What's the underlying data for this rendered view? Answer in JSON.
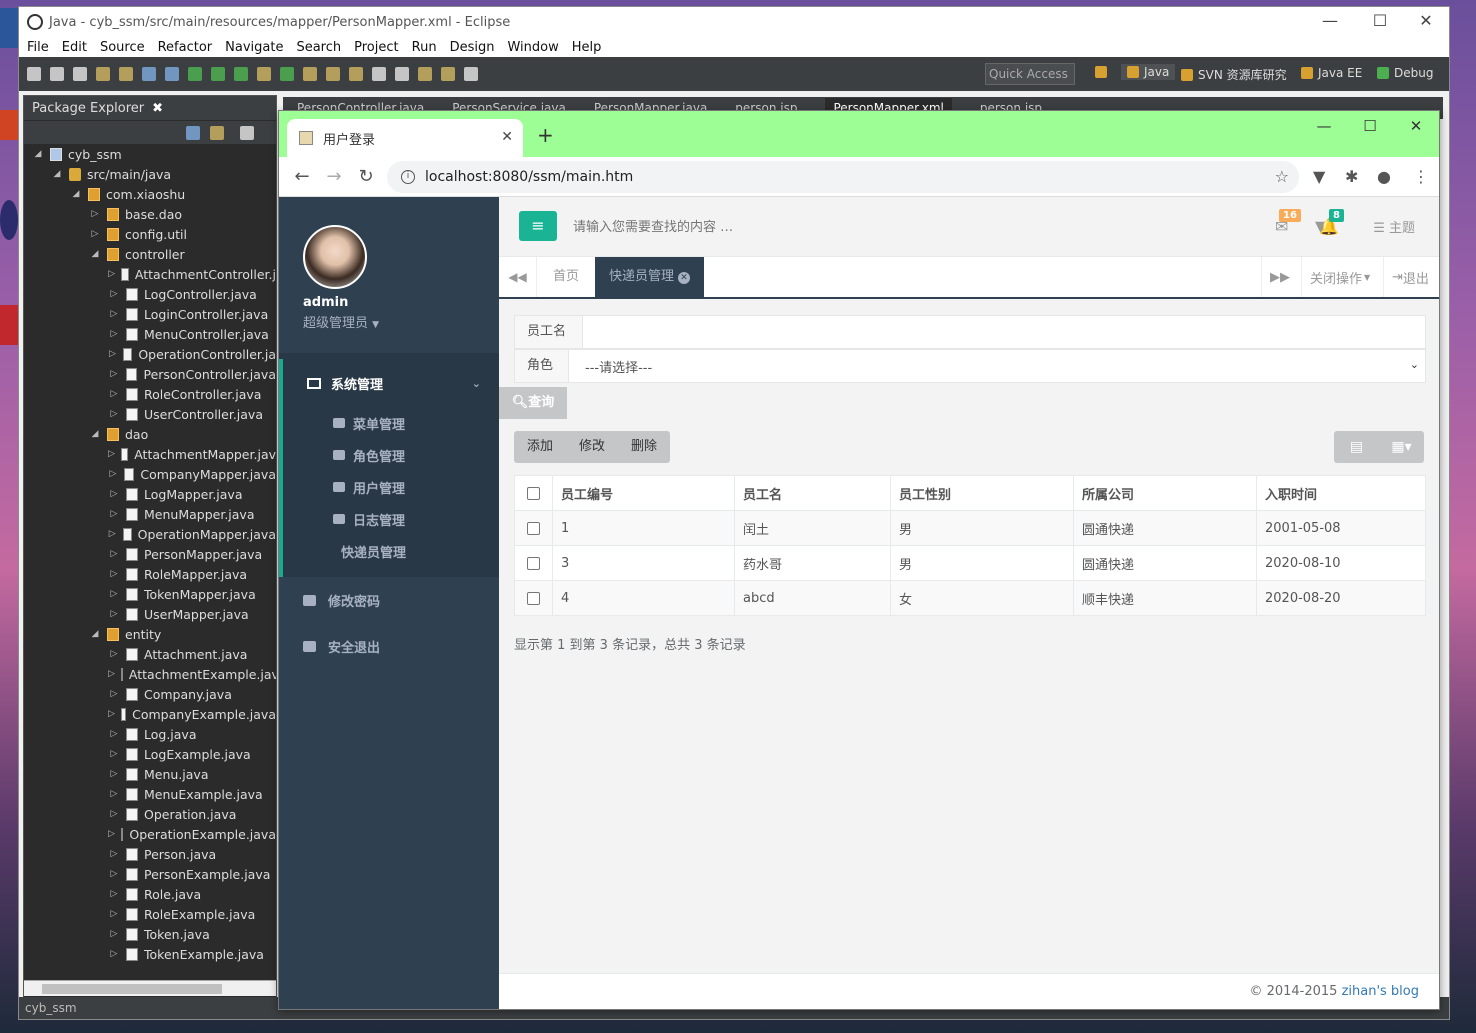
{
  "eclipse": {
    "title": "Java - cyb_ssm/src/main/resources/mapper/PersonMapper.xml - Eclipse",
    "menu": [
      "File",
      "Edit",
      "Source",
      "Refactor",
      "Navigate",
      "Search",
      "Project",
      "Run",
      "Design",
      "Window",
      "Help"
    ],
    "quick_access": "Quick Access",
    "perspectives": [
      "Java",
      "SVN 资源库研究",
      "Java EE",
      "Debug"
    ],
    "editor_tabs": [
      "PersonController.java",
      "PersonService.java",
      "PersonMapper.java",
      "person.jsp",
      "PersonMapper.xml",
      "person.jsp"
    ],
    "package_explorer": {
      "title": "Package Explorer",
      "tree": [
        {
          "label": "cyb_ssm",
          "depth": 0,
          "arrow": "◢",
          "icon": "proj"
        },
        {
          "label": "src/main/java",
          "depth": 1,
          "arrow": "◢",
          "icon": "folder"
        },
        {
          "label": "com.xiaoshu",
          "depth": 2,
          "arrow": "◢",
          "icon": "pkg"
        },
        {
          "label": "base.dao",
          "depth": 3,
          "arrow": "▷",
          "icon": "pkg"
        },
        {
          "label": "config.util",
          "depth": 3,
          "arrow": "▷",
          "icon": "pkg"
        },
        {
          "label": "controller",
          "depth": 3,
          "arrow": "◢",
          "icon": "pkg"
        },
        {
          "label": "AttachmentController.j",
          "depth": 4,
          "arrow": "▷",
          "icon": "java"
        },
        {
          "label": "LogController.java",
          "depth": 4,
          "arrow": "▷",
          "icon": "java"
        },
        {
          "label": "LoginController.java",
          "depth": 4,
          "arrow": "▷",
          "icon": "java"
        },
        {
          "label": "MenuController.java",
          "depth": 4,
          "arrow": "▷",
          "icon": "java"
        },
        {
          "label": "OperationController.ja",
          "depth": 4,
          "arrow": "▷",
          "icon": "java"
        },
        {
          "label": "PersonController.java",
          "depth": 4,
          "arrow": "▷",
          "icon": "java"
        },
        {
          "label": "RoleController.java",
          "depth": 4,
          "arrow": "▷",
          "icon": "java"
        },
        {
          "label": "UserController.java",
          "depth": 4,
          "arrow": "▷",
          "icon": "java"
        },
        {
          "label": "dao",
          "depth": 3,
          "arrow": "◢",
          "icon": "pkg"
        },
        {
          "label": "AttachmentMapper.jav",
          "depth": 4,
          "arrow": "▷",
          "icon": "ijava"
        },
        {
          "label": "CompanyMapper.java",
          "depth": 4,
          "arrow": "▷",
          "icon": "ijava"
        },
        {
          "label": "LogMapper.java",
          "depth": 4,
          "arrow": "▷",
          "icon": "ijava"
        },
        {
          "label": "MenuMapper.java",
          "depth": 4,
          "arrow": "▷",
          "icon": "ijava"
        },
        {
          "label": "OperationMapper.java",
          "depth": 4,
          "arrow": "▷",
          "icon": "ijava"
        },
        {
          "label": "PersonMapper.java",
          "depth": 4,
          "arrow": "▷",
          "icon": "ijava"
        },
        {
          "label": "RoleMapper.java",
          "depth": 4,
          "arrow": "▷",
          "icon": "ijava"
        },
        {
          "label": "TokenMapper.java",
          "depth": 4,
          "arrow": "▷",
          "icon": "ijava"
        },
        {
          "label": "UserMapper.java",
          "depth": 4,
          "arrow": "▷",
          "icon": "ijava"
        },
        {
          "label": "entity",
          "depth": 3,
          "arrow": "◢",
          "icon": "pkg"
        },
        {
          "label": "Attachment.java",
          "depth": 4,
          "arrow": "▷",
          "icon": "java"
        },
        {
          "label": "AttachmentExample.jav",
          "depth": 4,
          "arrow": "▷",
          "icon": "java"
        },
        {
          "label": "Company.java",
          "depth": 4,
          "arrow": "▷",
          "icon": "java"
        },
        {
          "label": "CompanyExample.java",
          "depth": 4,
          "arrow": "▷",
          "icon": "java"
        },
        {
          "label": "Log.java",
          "depth": 4,
          "arrow": "▷",
          "icon": "java"
        },
        {
          "label": "LogExample.java",
          "depth": 4,
          "arrow": "▷",
          "icon": "java"
        },
        {
          "label": "Menu.java",
          "depth": 4,
          "arrow": "▷",
          "icon": "java"
        },
        {
          "label": "MenuExample.java",
          "depth": 4,
          "arrow": "▷",
          "icon": "java"
        },
        {
          "label": "Operation.java",
          "depth": 4,
          "arrow": "▷",
          "icon": "java"
        },
        {
          "label": "OperationExample.java",
          "depth": 4,
          "arrow": "▷",
          "icon": "java"
        },
        {
          "label": "Person.java",
          "depth": 4,
          "arrow": "▷",
          "icon": "java"
        },
        {
          "label": "PersonExample.java",
          "depth": 4,
          "arrow": "▷",
          "icon": "java"
        },
        {
          "label": "Role.java",
          "depth": 4,
          "arrow": "▷",
          "icon": "java"
        },
        {
          "label": "RoleExample.java",
          "depth": 4,
          "arrow": "▷",
          "icon": "java"
        },
        {
          "label": "Token.java",
          "depth": 4,
          "arrow": "▷",
          "icon": "java"
        },
        {
          "label": "TokenExample.java",
          "depth": 4,
          "arrow": "▷",
          "icon": "java"
        }
      ]
    },
    "status": "cyb_ssm"
  },
  "chrome": {
    "tab_title": "用户登录",
    "url": "localhost:8080/ssm/main.htm"
  },
  "app": {
    "user": {
      "name": "admin",
      "role": "超级管理员"
    },
    "nav": {
      "group_label": "系统管理",
      "sub_items": [
        "菜单管理",
        "角色管理",
        "用户管理",
        "日志管理",
        "快递员管理"
      ],
      "top_items": [
        "修改密码",
        "安全退出"
      ]
    },
    "search_placeholder": "请输入您需要查找的内容 …",
    "badges": {
      "mail": "16",
      "bell": "8"
    },
    "theme": "主题",
    "tabs": {
      "home": "首页",
      "active": "快递员管理",
      "close_ops": "关闭操作",
      "logout": "退出"
    },
    "form": {
      "name_label": "员工名",
      "name_value": "",
      "role_label": "角色",
      "role_value": "---请选择---",
      "query": "查询"
    },
    "actions": [
      "添加",
      "修改",
      "删除"
    ],
    "table": {
      "headers": [
        "员工编号",
        "员工名",
        "员工性别",
        "所属公司",
        "入职时间"
      ],
      "rows": [
        [
          "1",
          "闰土",
          "男",
          "圆通快递",
          "2001-05-08"
        ],
        [
          "3",
          "药水哥",
          "男",
          "圆通快递",
          "2020-08-10"
        ],
        [
          "4",
          "abcd",
          "女",
          "顺丰快递",
          "2020-08-20"
        ]
      ]
    },
    "summary": "显示第 1 到第 3 条记录，总共 3 条记录",
    "footer": {
      "copyright": "© 2014-2015 ",
      "link": "zihan's blog"
    }
  }
}
